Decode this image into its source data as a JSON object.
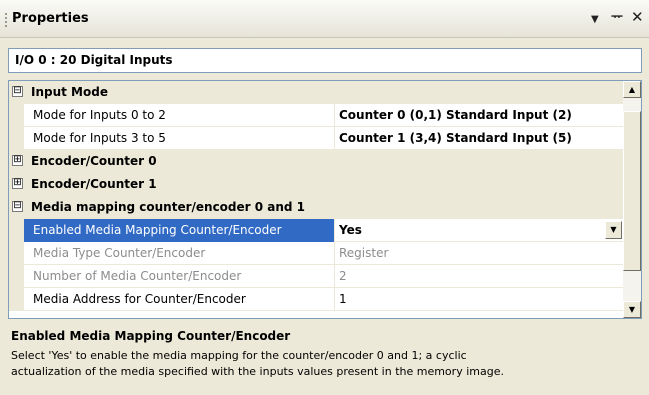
{
  "panel": {
    "title": "Properties",
    "dropdown_glyph": "▼",
    "pin_glyph": "ᅲ",
    "close_glyph": "✕"
  },
  "object_selector": {
    "value": "I/O 0 : 20 Digital Inputs"
  },
  "grid": {
    "categories": [
      {
        "label": "Input Mode",
        "toggle": "⊟",
        "expanded": true,
        "properties": [
          {
            "name": "Mode for Inputs 0 to 2",
            "value": "Counter 0 (0,1) Standard Input (2)"
          },
          {
            "name": "Mode for Inputs 3 to 5",
            "value": "Counter 1 (3,4) Standard Input (5)"
          }
        ]
      },
      {
        "label": "Encoder/Counter 0",
        "toggle": "⊞",
        "expanded": false
      },
      {
        "label": "Encoder/Counter 1",
        "toggle": "⊞",
        "expanded": false
      },
      {
        "label": "Media mapping counter/encoder 0 and 1",
        "toggle": "⊟",
        "expanded": true,
        "properties": [
          {
            "name": "Enabled Media Mapping Counter/Encoder",
            "value": "Yes",
            "selected": true
          },
          {
            "name": "Media Type Counter/Encoder",
            "value": "Register",
            "readonly": true
          },
          {
            "name": "Number of Media Counter/Encoder",
            "value": "2",
            "readonly": true
          },
          {
            "name": "Media Address for Counter/Encoder",
            "value": "1"
          }
        ]
      }
    ]
  },
  "description": {
    "title": "Enabled Media Mapping Counter/Encoder",
    "line1": "Select 'Yes' to enable the media mapping for the counter/encoder 0 and 1; a cyclic",
    "line2": "actualization of the media specified with the inputs values present in the memory image."
  },
  "colors": {
    "selection": "#316ac5",
    "panel_bg": "#ece9d8",
    "border": "#7f9db9"
  }
}
